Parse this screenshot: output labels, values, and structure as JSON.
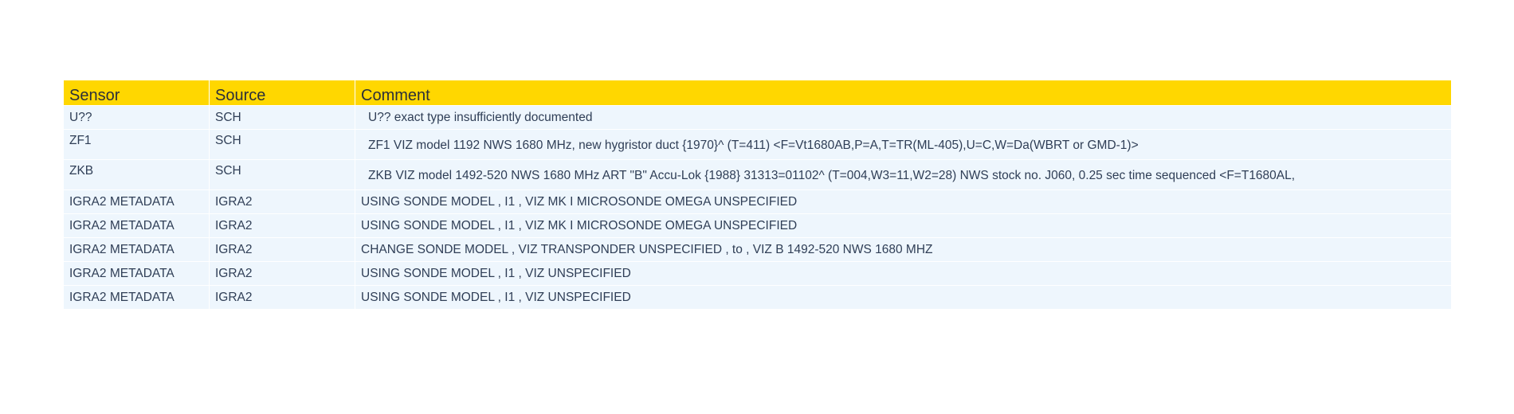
{
  "table": {
    "headers": {
      "sensor": "Sensor",
      "source": "Source",
      "comment": "Comment"
    },
    "rows": [
      {
        "sensor": "U??",
        "source": "SCH",
        "comment": "U?? exact type insufficiently documented"
      },
      {
        "sensor": "ZF1",
        "source": "SCH",
        "comment": "ZF1 VIZ model 1192 NWS 1680 MHz, new hygristor duct {1970}^ (T=411) <F=Vt1680AB,P=A,T=TR(ML-405),U=C,W=Da(WBRT or GMD-1)>"
      },
      {
        "sensor": "ZKB",
        "source": "SCH",
        "comment": "ZKB VIZ model 1492-520 NWS 1680 MHz ART \"B\" Accu-Lok {1988} 31313=01102^ (T=004,W3=11,W2=28) NWS stock no. J060, 0.25 sec time sequenced <F=T1680AL,"
      },
      {
        "sensor": "IGRA2 METADATA",
        "source": "IGRA2",
        "comment": "USING SONDE MODEL , I1 , VIZ MK I MICROSONDE OMEGA UNSPECIFIED"
      },
      {
        "sensor": "IGRA2 METADATA",
        "source": "IGRA2",
        "comment": "USING SONDE MODEL , I1 , VIZ MK I MICROSONDE OMEGA UNSPECIFIED"
      },
      {
        "sensor": "IGRA2 METADATA",
        "source": "IGRA2",
        "comment": "CHANGE SONDE MODEL , VIZ TRANSPONDER UNSPECIFIED , to , VIZ B 1492-520 NWS 1680 MHZ"
      },
      {
        "sensor": "IGRA2 METADATA",
        "source": "IGRA2",
        "comment": "USING SONDE MODEL , I1 , VIZ UNSPECIFIED"
      },
      {
        "sensor": "IGRA2 METADATA",
        "source": "IGRA2",
        "comment": "USING SONDE MODEL , I1 , VIZ UNSPECIFIED"
      }
    ]
  },
  "colors": {
    "header_bg": "#ffd700",
    "row_bg": "#eef6fd",
    "text": "#2f3e56"
  }
}
